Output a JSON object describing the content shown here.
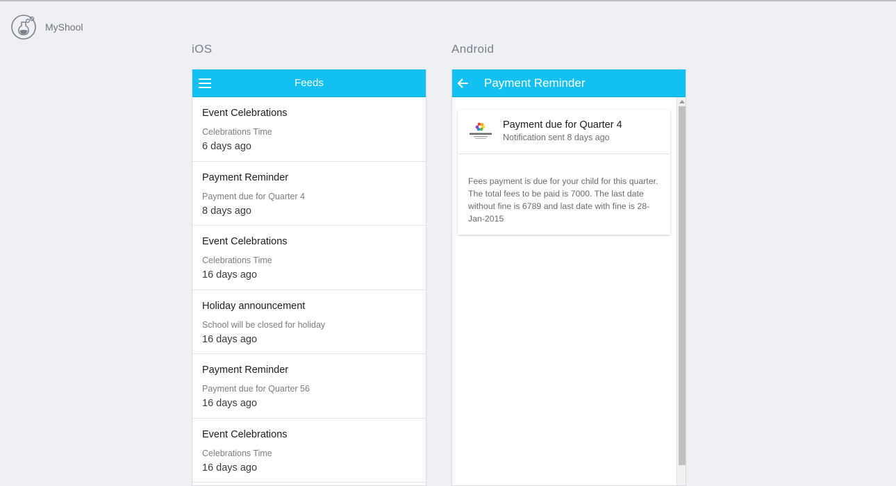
{
  "app": {
    "name": "MyShool",
    "logo_icon": "flask-logo-icon"
  },
  "columns": {
    "ios_title": "iOS",
    "android_title": "Android"
  },
  "ios": {
    "bar_title": "Feeds",
    "menu_icon": "hamburger-menu-icon",
    "accent": "#12c0f2",
    "feeds": [
      {
        "title": "Event Celebrations",
        "subtitle": "Celebrations Time",
        "time": "6 days ago"
      },
      {
        "title": "Payment Reminder",
        "subtitle": "Payment due for Quarter 4",
        "time": "8 days ago"
      },
      {
        "title": "Event Celebrations",
        "subtitle": "Celebrations Time",
        "time": "16 days ago"
      },
      {
        "title": "Holiday announcement",
        "subtitle": "School will be closed for holiday",
        "time": "16 days ago"
      },
      {
        "title": "Payment Reminder",
        "subtitle": "Payment due for Quarter 56",
        "time": "16 days ago"
      },
      {
        "title": "Event Celebrations",
        "subtitle": "Celebrations Time",
        "time": "16 days ago"
      }
    ]
  },
  "android": {
    "bar_title": "Payment Reminder",
    "back_icon": "arrow-left-icon",
    "card": {
      "avatar_icon": "sanskriti-school-logo",
      "title": "Payment due for Quarter 4",
      "subtitle": "Notification sent 8 days ago",
      "body": "Fees payment is due for your child for this quarter. The total fees to be paid is 7000. The last date without fine is 6789 and last date with fine is 28-Jan-2015"
    }
  }
}
